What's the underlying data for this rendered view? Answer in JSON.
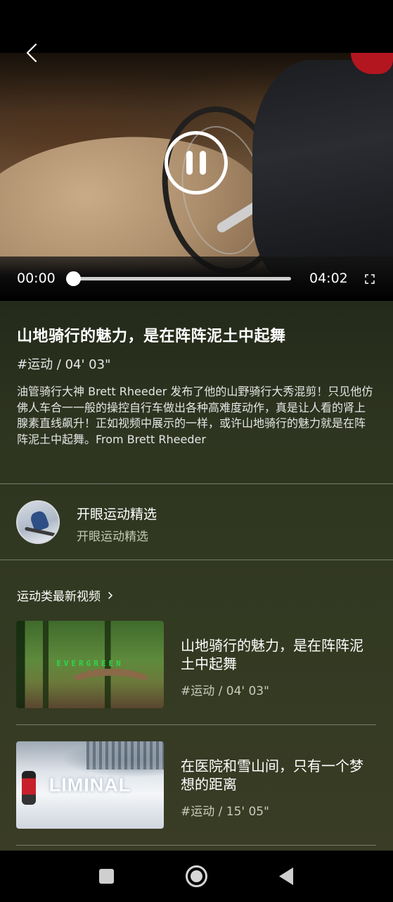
{
  "player": {
    "time_current": "00:00",
    "time_total": "04:02",
    "progress": 0,
    "state": "playing",
    "icons": {
      "back": "chevron-left-icon",
      "pause": "pause-icon",
      "fullscreen": "fullscreen-icon"
    }
  },
  "video": {
    "title": "山地骑行的魅力，是在阵阵泥土中起舞",
    "tag": "#运动 / 04' 03\"",
    "description": "油管骑行大神 Brett Rheeder 发布了他的山野骑行大秀混剪！只见他仿佛人车合一一般的操控自行车做出各种高难度动作，真是让人看的肾上腺素直线飙升！正如视频中展示的一样，或许山地骑行的魅力就是在阵阵泥土中起舞。From Brett Rheeder"
  },
  "author": {
    "name": "开眼运动精选",
    "subtitle": "开眼运动精选"
  },
  "related": {
    "section_title": "运动类最新视频",
    "items": [
      {
        "title": "山地骑行的魅力，是在阵阵泥土中起舞",
        "tag": "#运动 / 04' 03\"",
        "thumb_text": "EVERGREEN"
      },
      {
        "title": "在医院和雪山间，只有一个梦想的距离",
        "tag": "#运动 / 15' 05\"",
        "thumb_text": "LIMINAL"
      }
    ]
  },
  "nav_bar": {
    "icons": [
      "recents-square-icon",
      "home-circle-icon",
      "back-triangle-icon"
    ]
  },
  "colors": {
    "content_bg": "#2e3520",
    "accent_green": "#2bd84a"
  }
}
